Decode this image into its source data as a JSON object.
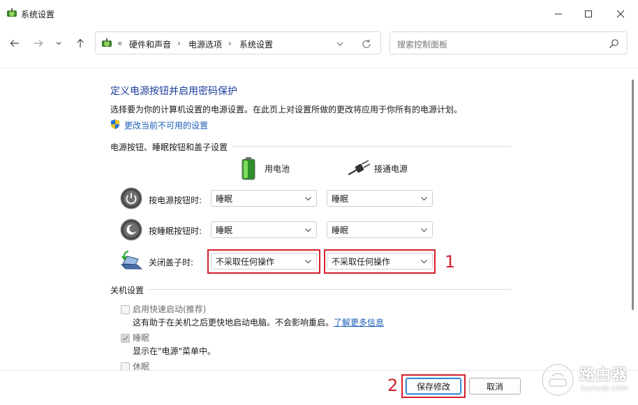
{
  "window": {
    "title": "系统设置"
  },
  "nav": {
    "breadcrumb_sep": "«",
    "crumbs": [
      "硬件和声音",
      "电源选项",
      "系统设置"
    ],
    "crumb_arrow": "›",
    "search_placeholder": "搜索控制面板"
  },
  "content": {
    "heading": "定义电源按钮并启用密码保护",
    "description": "选择要为你的计算机设置的电源设置。在此页上对设置所做的更改将应用于你所有的电源计划。",
    "change_link": "更改当前不可用的设置",
    "group_buttons_label": "电源按钮、睡眠按钮和盖子设置",
    "col_battery": "用电池",
    "col_plugged": "接通电源",
    "rows": [
      {
        "label": "按电源按钮时:",
        "battery": "睡眠",
        "plugged": "睡眠"
      },
      {
        "label": "按睡眠按钮时:",
        "battery": "睡眠",
        "plugged": "睡眠"
      },
      {
        "label": "关闭盖子时:",
        "battery": "不采取任何操作",
        "plugged": "不采取任何操作"
      }
    ],
    "annotation_1": "1",
    "annotation_2": "2",
    "group_shutdown_label": "关机设置",
    "options": [
      {
        "label": "启用快速启动(推荐)",
        "checked": false,
        "desc": "这有助于在关机之后更快地启动电脑。不会影响重启。",
        "link": "了解更多信息"
      },
      {
        "label": "睡眠",
        "checked": true,
        "desc": "显示在\"电源\"菜单中。"
      },
      {
        "label": "休眠",
        "checked": false
      }
    ]
  },
  "buttons": {
    "save": "保存修改",
    "cancel": "取消"
  },
  "watermark": {
    "text": "路由器",
    "sub": "luyouqi.com"
  },
  "colors": {
    "heading_blue": "#1b3d9c",
    "link_blue": "#1b5fb8",
    "annotation_red": "#d61f2e",
    "primary_border": "#0067c0"
  }
}
